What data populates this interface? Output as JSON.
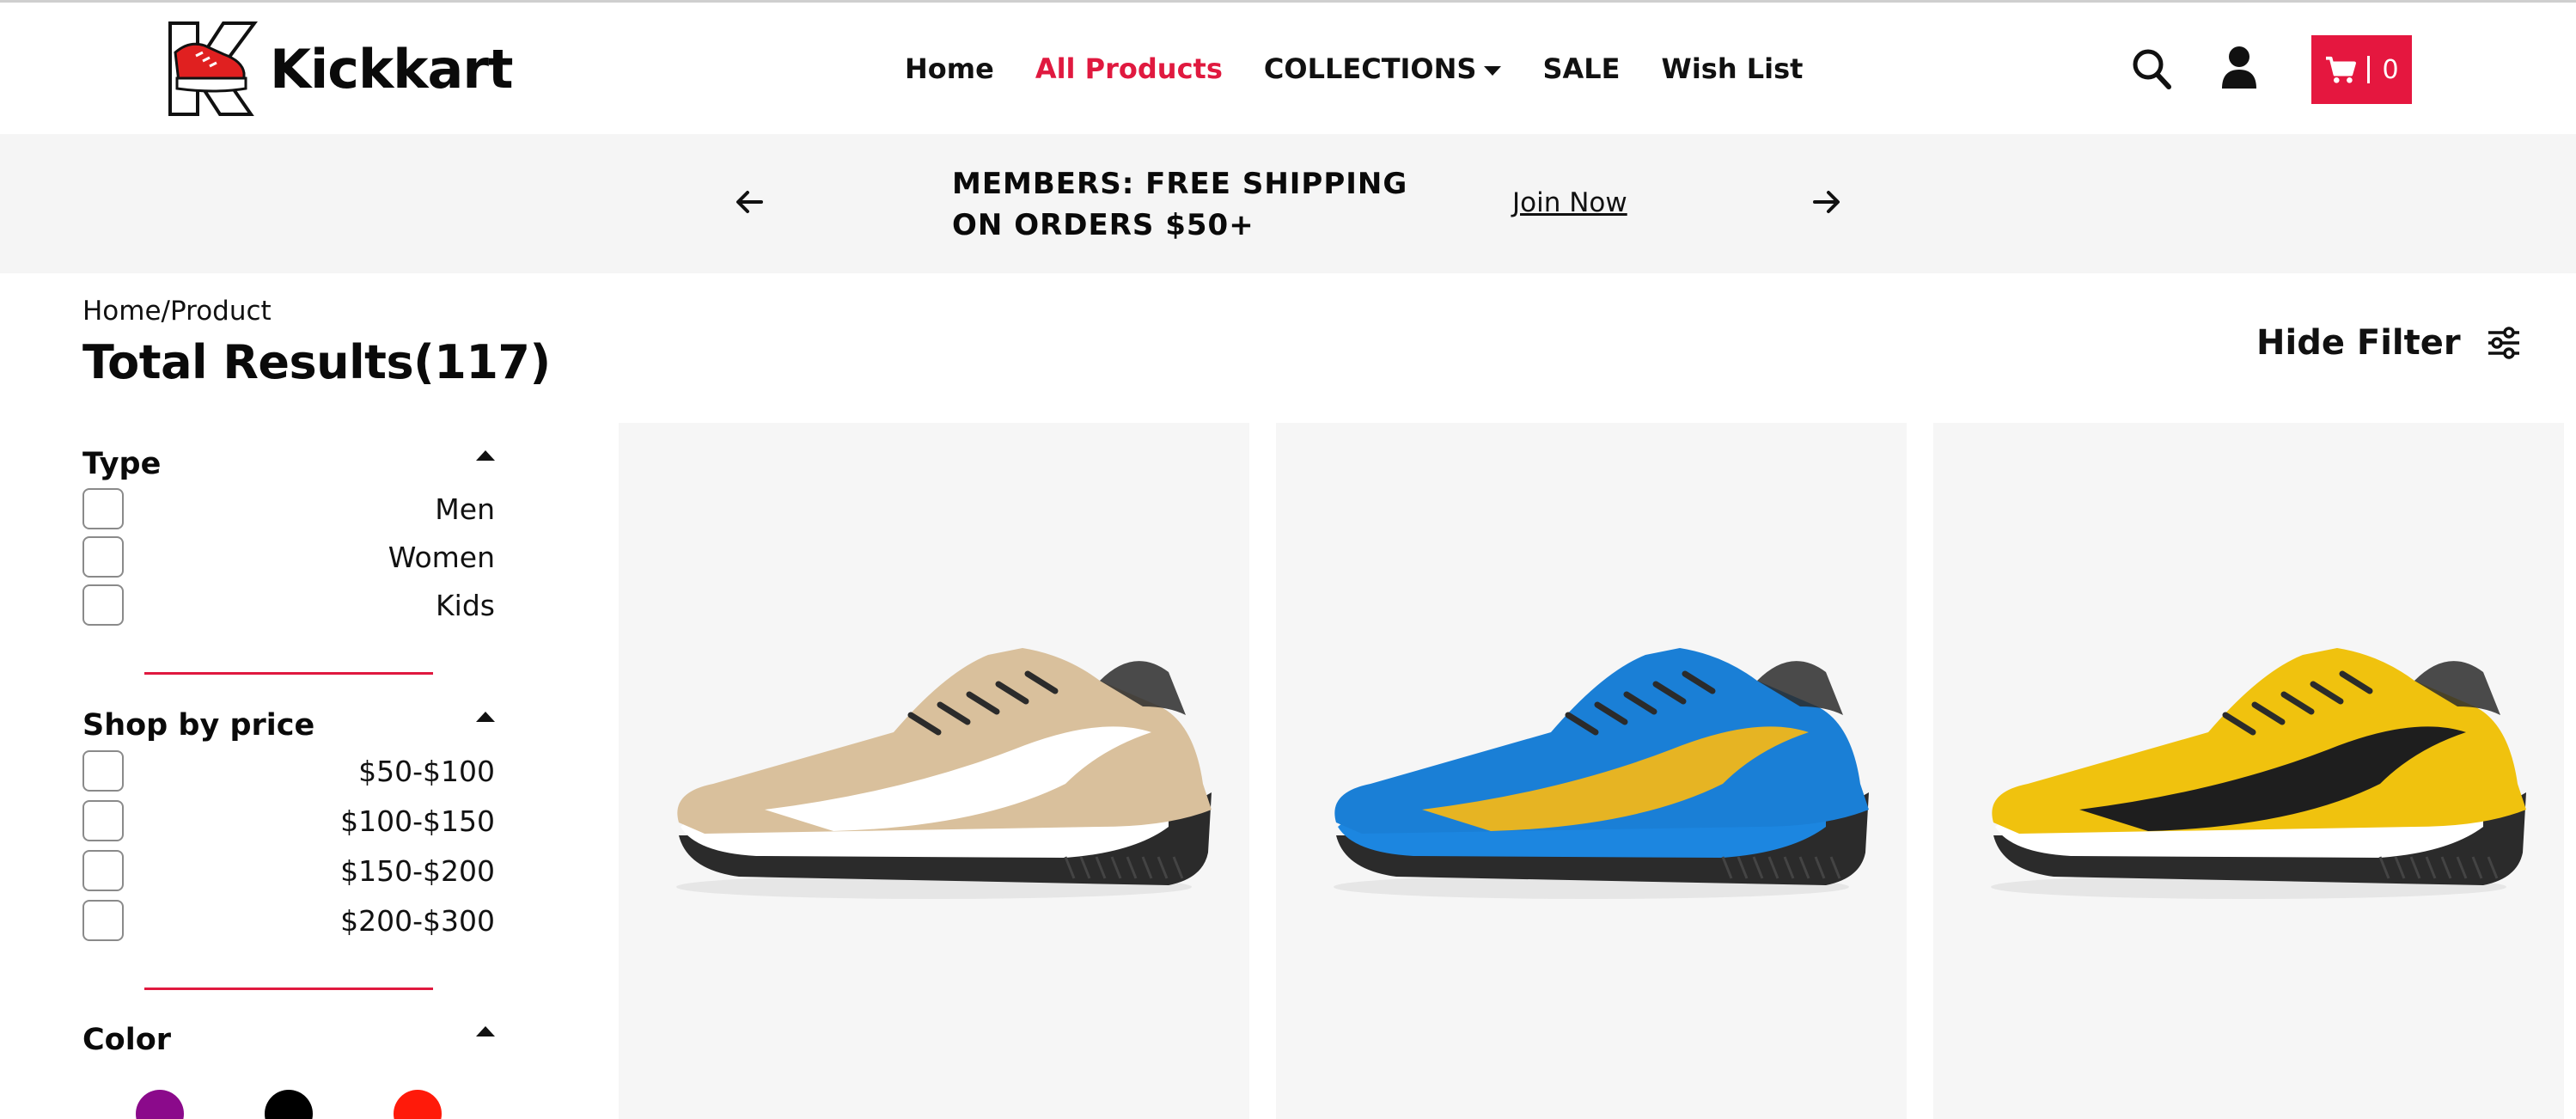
{
  "brand": {
    "name": "Kickkart"
  },
  "nav": {
    "items": [
      {
        "label": "Home"
      },
      {
        "label": "All Products"
      },
      {
        "label": "COLLECTIONS"
      },
      {
        "label": "SALE"
      },
      {
        "label": "Wish List"
      }
    ],
    "active": "All Products"
  },
  "header": {
    "cart_count": "0"
  },
  "promo": {
    "message": "MEMBERS: FREE SHIPPING ON ORDERS $50+",
    "link": "Join Now"
  },
  "breadcrumb": "Home/Product",
  "results": {
    "title": "Total Results(117)"
  },
  "filter_toggle": "Hide Filter",
  "filters": {
    "type": {
      "title": "Type",
      "options": [
        "Men",
        "Women",
        "Kids"
      ]
    },
    "price": {
      "title": "Shop by price",
      "options": [
        "$50-$100",
        "$100-$150",
        "$150-$200",
        "$200-$300"
      ]
    },
    "color": {
      "title": "Color",
      "swatches": [
        "#8b0a8b",
        "#000000",
        "#ff1a0a"
      ]
    }
  },
  "products": [
    {
      "colorway": "beige",
      "primary": "#d9c09c",
      "stripe": "#ffffff",
      "sole": "#2b2b2b",
      "midsole": "#ffffff"
    },
    {
      "colorway": "blue",
      "primary": "#1a7fd6",
      "stripe": "#e6b423",
      "sole": "#2b2b2b",
      "midsole": "#1c86e0"
    },
    {
      "colorway": "yellow",
      "primary": "#f0c20e",
      "stripe": "#1e1e1e",
      "sole": "#2b2b2b",
      "midsole": "#ffffff"
    }
  ],
  "colors": {
    "accent": "#e5173f",
    "banner_bg": "#f5f5f5",
    "card_bg": "#f6f6f6"
  }
}
